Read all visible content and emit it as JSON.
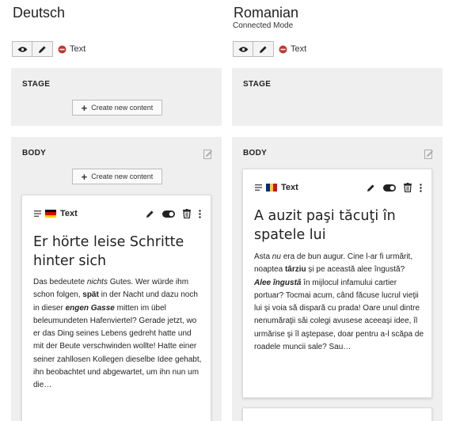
{
  "left": {
    "language": "Deutsch",
    "mode": "",
    "toolbar": {
      "view_icon": "eye-icon",
      "edit_icon": "pencil-icon",
      "hidden_icon": "minus-circle-icon",
      "label": "Text"
    },
    "stage": {
      "title": "STAGE",
      "create_label": "Create new content"
    },
    "body": {
      "title": "BODY",
      "create_label": "Create new content",
      "card": {
        "type": "Text",
        "flag": "de",
        "heading": "Er hörte leise Schritte hinter sich",
        "text": [
          {
            "t": "Das bedeutete "
          },
          {
            "t": "nichts",
            "i": true
          },
          {
            "t": " Gutes. Wer würde ihm schon folgen, "
          },
          {
            "t": "spät",
            "b": true
          },
          {
            "t": " in der Nacht und dazu noch in dieser "
          },
          {
            "t": "engen Gasse",
            "b": true,
            "i": true
          },
          {
            "t": " mitten im übel beleumundeten Hafenviertel? Gerade jetzt, wo er das Ding seines Lebens gedreht hatte und mit der Beute verschwinden wollte! Hatte einer seiner zahllosen Kollegen dieselbe Idee gehabt, ihn beobachtet und abgewartet, um ihn nun um die…"
          }
        ]
      }
    }
  },
  "right": {
    "language": "Romanian",
    "mode": "Connected Mode",
    "toolbar": {
      "view_icon": "eye-icon",
      "edit_icon": "pencil-icon",
      "hidden_icon": "minus-circle-icon",
      "label": "Text"
    },
    "stage": {
      "title": "STAGE"
    },
    "body": {
      "title": "BODY",
      "card": {
        "type": "Text",
        "flag": "ro",
        "heading": "A auzit paşi tăcuţi în spatele lui",
        "text": [
          {
            "t": "Asta "
          },
          {
            "t": "nu",
            "i": true
          },
          {
            "t": " era de bun augur. Cine l-ar fi urmărit, noaptea "
          },
          {
            "t": "târziu",
            "b": true
          },
          {
            "t": " și pe această alee îngustă? "
          },
          {
            "t": "Alee îngustă",
            "b": true,
            "i": true
          },
          {
            "t": " în mijlocul infamului cartier portuar? Tocmai acum, când făcuse lucrul vieţii lui şi voia să dispară cu prada! Oare unul dintre nenumăraţii săi colegi avusese aceeaşi idee, îl urmărise şi îl aştepase, doar pentru a-l scăpa de roadele muncii sale? Sau…"
          }
        ]
      }
    }
  },
  "colors": {
    "panel_bg": "#efefef",
    "hidden_red": "#c0392b"
  }
}
